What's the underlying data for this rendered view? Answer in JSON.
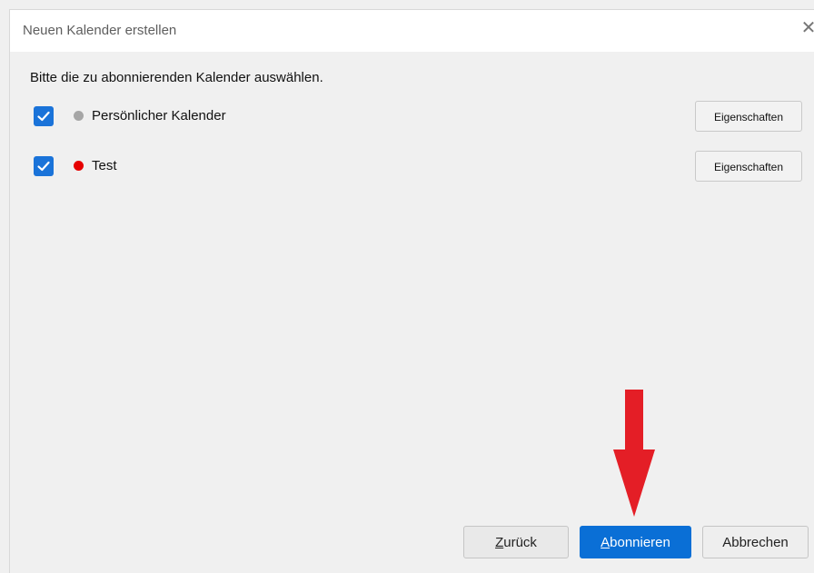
{
  "dialog": {
    "title": "Neuen Kalender erstellen",
    "instruction": "Bitte die zu abonnierenden Kalender auswählen."
  },
  "calendars": [
    {
      "name": "Persönlicher Kalender",
      "checked": true,
      "color": "#a6a6a6",
      "properties_label": "Eigenschaften"
    },
    {
      "name": "Test",
      "checked": true,
      "color": "#e60000",
      "properties_label": "Eigenschaften"
    }
  ],
  "buttons": {
    "back": {
      "accel": "Z",
      "rest": "urück"
    },
    "subscribe": {
      "accel": "A",
      "rest": "bonnieren"
    },
    "cancel": "Abbrechen"
  },
  "annotation": {
    "arrow_color": "#e41e26"
  },
  "icons": {
    "close": "close-icon",
    "checkmark": "checkmark-icon",
    "annotation": "down-arrow-icon"
  }
}
